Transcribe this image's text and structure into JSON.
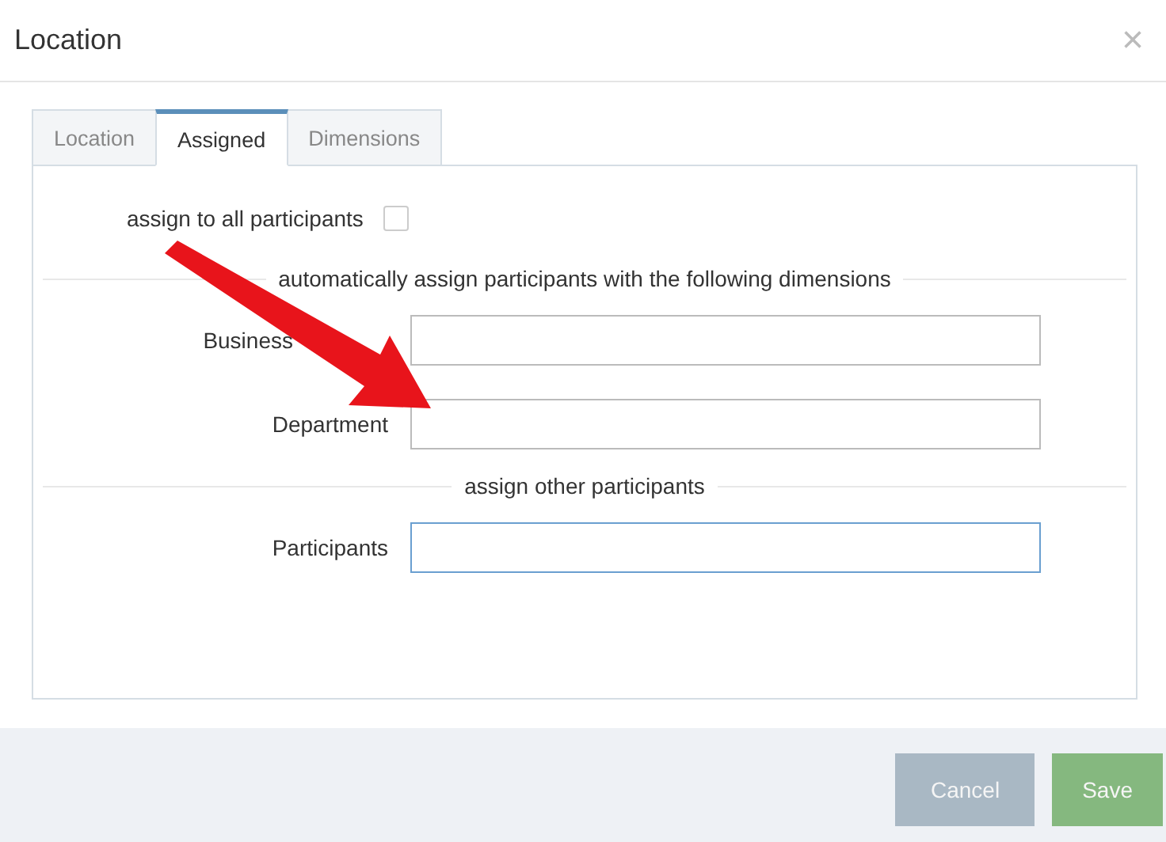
{
  "dialog": {
    "title": "Location",
    "close": "×"
  },
  "tabs": [
    {
      "label": "Location",
      "selected": false
    },
    {
      "label": "Assigned",
      "selected": true
    },
    {
      "label": "Dimensions",
      "selected": false
    }
  ],
  "assign_all": {
    "label": "assign to all participants",
    "checked": false
  },
  "sections": [
    {
      "heading": "automatically assign participants with the following dimensions",
      "fields": [
        {
          "label": "Business",
          "focused": false,
          "covered_by_arrow": true
        },
        {
          "label": "Department",
          "focused": false
        }
      ]
    },
    {
      "heading": "assign other participants",
      "fields": [
        {
          "label": "Participants",
          "focused": true
        }
      ]
    }
  ],
  "buttons": [
    {
      "label": "Cancel",
      "kind": "secondary"
    },
    {
      "label": "Save",
      "kind": "primary"
    }
  ]
}
